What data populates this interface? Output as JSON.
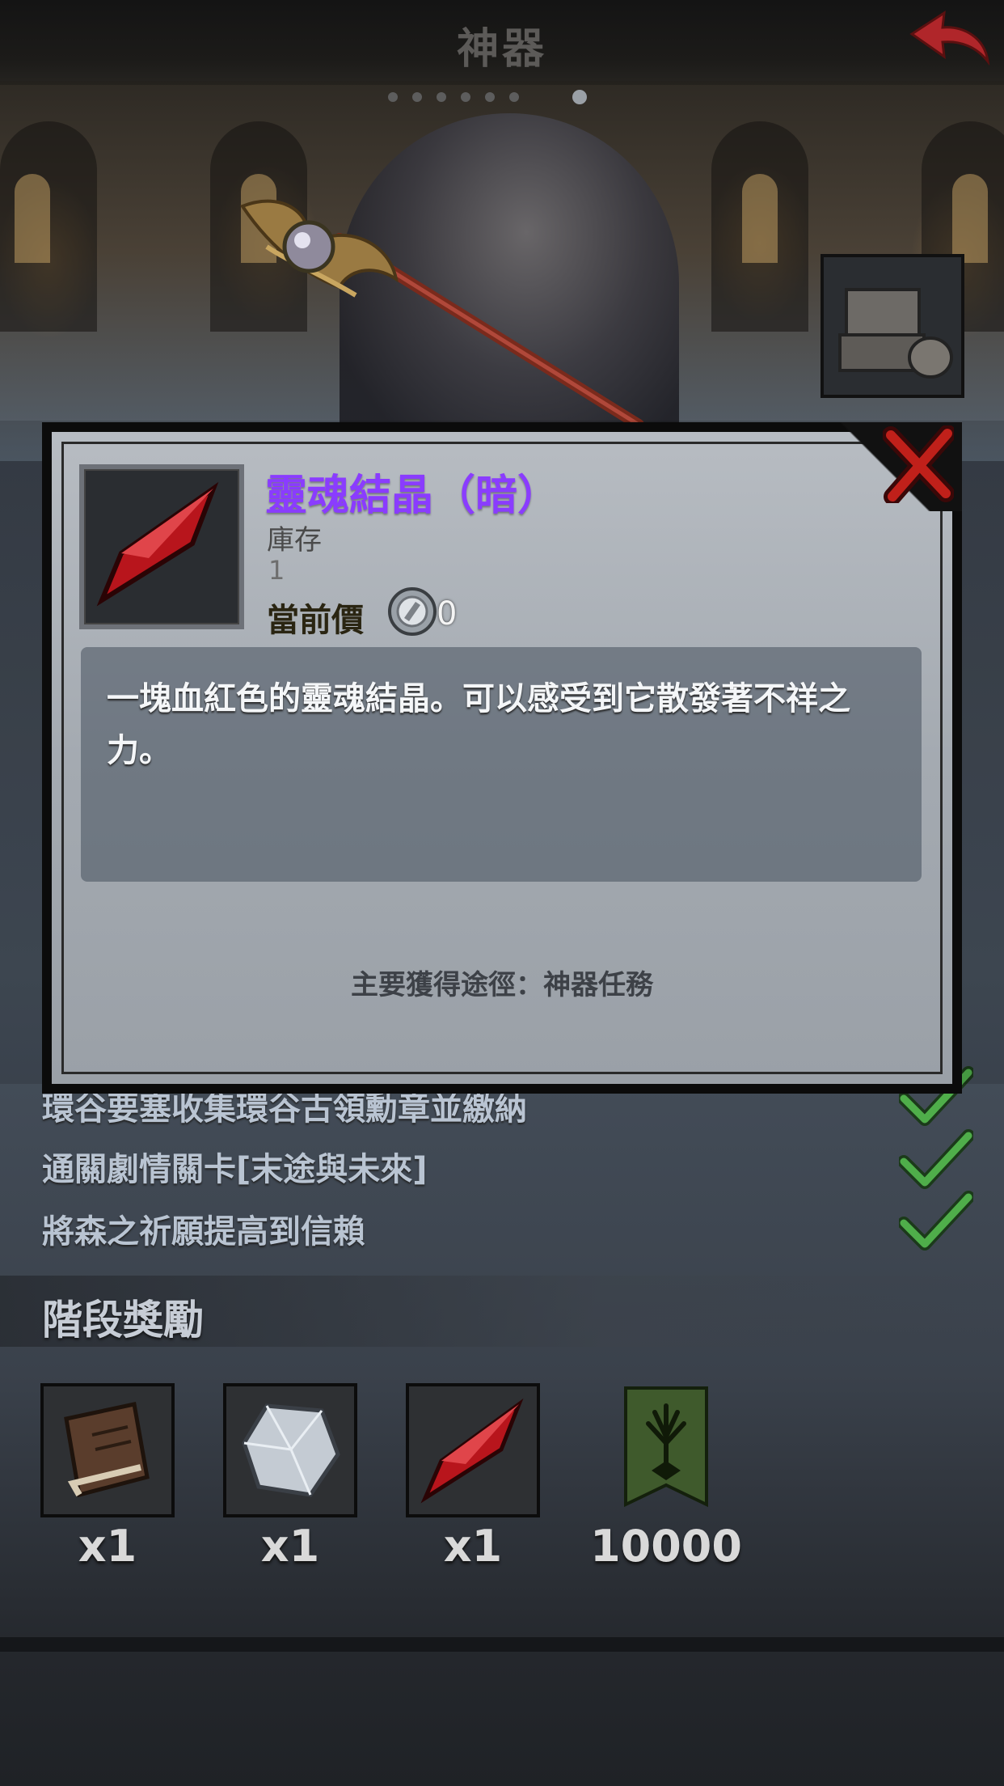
{
  "header": {
    "title": "神器"
  },
  "modal": {
    "item_name": "靈魂結晶（暗）",
    "stock_label": "庫存",
    "stock_value": "1",
    "price_label": "當前價",
    "price_value": "0",
    "description": "一塊血紅色的靈魂結晶。可以感受到它散發著不祥之力。",
    "source": "主要獲得途徑：神器任務"
  },
  "conditions": [
    {
      "text": "環谷要塞收集環谷古領勳章並繳納",
      "done": true
    },
    {
      "text": "通關劇情關卡[末途與未來]",
      "done": true
    },
    {
      "text": "將森之祈願提高到信賴",
      "done": true
    }
  ],
  "rewards": {
    "title": "階段獎勵",
    "items": [
      {
        "icon": "leather-book-icon",
        "count": "x1"
      },
      {
        "icon": "white-crystal-icon",
        "count": "x1"
      },
      {
        "icon": "red-crystal-icon",
        "count": "x1"
      },
      {
        "icon": "tree-banner-icon",
        "count": "10000"
      }
    ]
  },
  "colors": {
    "item_name": "#8a3cff",
    "check": "#4fae4a",
    "close": "#c0201a"
  }
}
